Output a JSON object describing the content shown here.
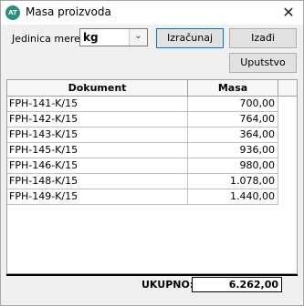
{
  "window": {
    "title": "Masa proizvoda",
    "icon_text": "AT",
    "close_glyph": "✕"
  },
  "form": {
    "unit_label": "Jedinica mere:",
    "unit_value": "kg",
    "calculate_label": "Izračunaj",
    "exit_label": "Izađi",
    "help_label": "Uputstvo"
  },
  "table": {
    "columns": [
      "Dokument",
      "Masa"
    ],
    "rows": [
      {
        "document": "FPH-141-K/15",
        "mass": "700,00"
      },
      {
        "document": "FPH-142-K/15",
        "mass": "764,00"
      },
      {
        "document": "FPH-143-K/15",
        "mass": "364,00"
      },
      {
        "document": "FPH-145-K/15",
        "mass": "936,00"
      },
      {
        "document": "FPH-146-K/15",
        "mass": "980,00"
      },
      {
        "document": "FPH-148-K/15",
        "mass": "1.078,00"
      },
      {
        "document": "FPH-149-K/15",
        "mass": "1.440,00"
      }
    ]
  },
  "footer": {
    "total_label": "UKUPNO:",
    "total_value": "6.262,00"
  }
}
